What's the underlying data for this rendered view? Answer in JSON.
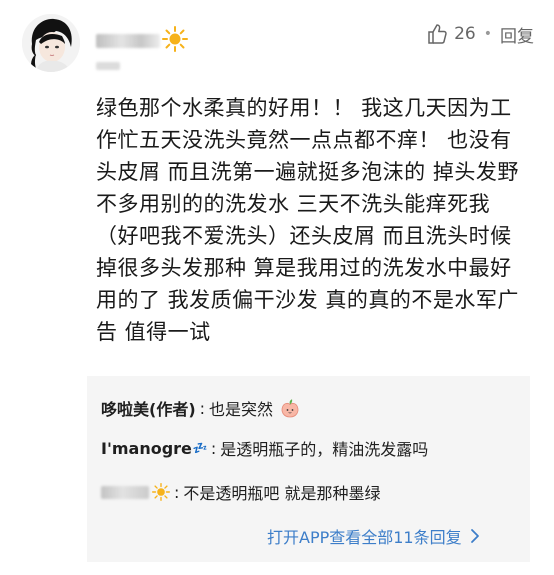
{
  "comment": {
    "like_count": "26",
    "reply_label": "回复",
    "separator": "•",
    "text": "绿色那个水柔真的好用！！ 我这几天因为工\n作忙五天没洗头竟然一点点都不痒！ 也没有\n头皮屑 而且洗第一遍就挺多泡沫的 掉头发野\n不多用别的的洗发水 三天不洗头能痒死我\n（好吧我不爱洗头）还头皮屑 而且洗头时候\n掉很多头发那种 算是我用过的洗发水中最好\n用的了 我发质偏干沙发 真的真的不是水军广\n告 值得一试"
  },
  "replies": [
    {
      "name": "哆啦美(作者)",
      "text": "也是突然"
    },
    {
      "name": "I'manogre",
      "badge": "💤",
      "text": "是透明瓶子的，精油洗发露吗"
    },
    {
      "name": "",
      "text": "不是透明瓶吧 就是那种墨绿"
    }
  ],
  "open_app": {
    "label": "打开APP查看全部11条回复"
  },
  "colors": {
    "link": "#3d7ec9",
    "reply_bg": "#f5f5f5",
    "sun": "#f6b21a"
  }
}
